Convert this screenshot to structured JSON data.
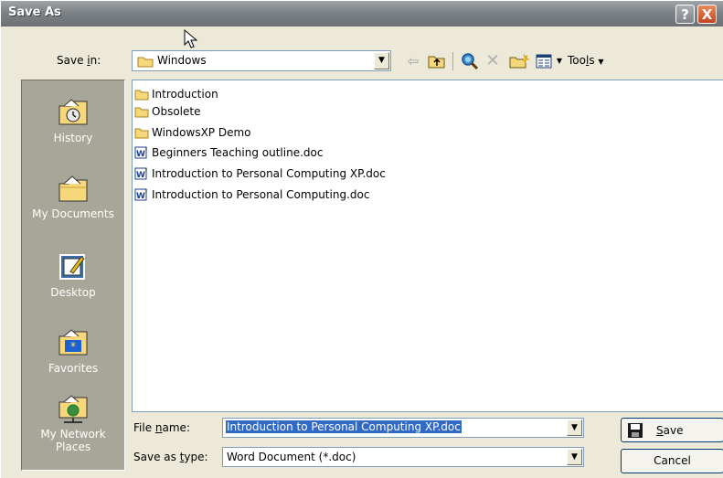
{
  "window": {
    "title": "Save As",
    "help_glyph": "?",
    "close_glyph": "X"
  },
  "toolbar": {
    "save_in_prefix": "Save ",
    "save_in_u": "i",
    "save_in_suffix": "n:",
    "location": "Windows",
    "tools_prefix": "Too",
    "tools_u": "l",
    "tools_suffix": "s",
    "icons": [
      "back-icon",
      "up-folder-icon",
      "search-web-icon",
      "delete-icon",
      "new-folder-icon",
      "views-icon",
      "tools-dropdown-icon"
    ]
  },
  "places": [
    {
      "label": "History",
      "icon": "history-icon"
    },
    {
      "label": "My Documents",
      "icon": "my-documents-icon"
    },
    {
      "label": "Desktop",
      "icon": "desktop-icon"
    },
    {
      "label": "Favorites",
      "icon": "favorites-icon"
    },
    {
      "label": "My Network Places",
      "icon": "network-places-icon"
    }
  ],
  "files": [
    {
      "name": "Introduction",
      "type": "folder"
    },
    {
      "name": "Obsolete",
      "type": "folder"
    },
    {
      "name": "WindowsXP Demo",
      "type": "folder"
    },
    {
      "name": "Beginners Teaching outline.doc",
      "type": "doc"
    },
    {
      "name": "Introduction to Personal Computing XP.doc",
      "type": "doc"
    },
    {
      "name": "Introduction to Personal Computing.doc",
      "type": "doc"
    }
  ],
  "form": {
    "filename_label_prefix": "File ",
    "filename_label_u": "n",
    "filename_label_suffix": "ame:",
    "filename_value": "Introduction to Personal Computing XP.doc",
    "type_label_prefix": "Save as ",
    "type_label_u": "t",
    "type_label_suffix": "ype:",
    "type_value": "Word Document (*.doc)"
  },
  "buttons": {
    "save_u": "S",
    "save_rest": "ave",
    "cancel": "Cancel"
  },
  "colors": {
    "selection": "#316ac5",
    "places_bg": "#a7a698",
    "dialog_bg": "#ece9d8"
  }
}
